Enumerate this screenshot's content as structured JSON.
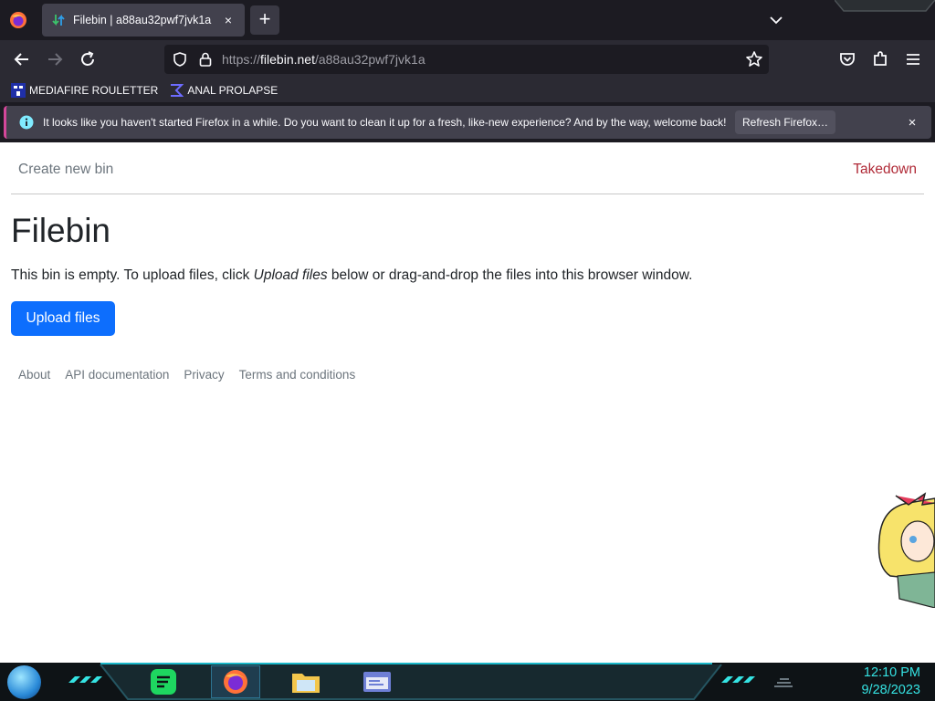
{
  "browser": {
    "tab": {
      "title": "Filebin | a88au32pwf7jvk1a",
      "close": "×"
    },
    "new_tab": "+",
    "url": {
      "scheme": "https://",
      "domain": "filebin.net",
      "path": "/a88au32pwf7jvk1a"
    },
    "bookmarks": [
      {
        "label": "MEDIAFIRE ROULETTER"
      },
      {
        "label": "ANAL PROLAPSE"
      }
    ],
    "notification": {
      "text": "It looks like you haven't started Firefox in a while. Do you want to clean it up for a fresh, like-new experience? And by the way, welcome back!",
      "button": "Refresh Firefox…",
      "close": "×"
    }
  },
  "page": {
    "nav": {
      "create": "Create new bin",
      "takedown": "Takedown"
    },
    "heading": "Filebin",
    "description": {
      "before": "This bin is empty. To upload files, click ",
      "emphasis": "Upload files",
      "after": " below or drag-and-drop the files into this browser window."
    },
    "upload_button": "Upload files",
    "footer": [
      "About",
      "API documentation",
      "Privacy",
      "Terms and conditions"
    ]
  },
  "taskbar": {
    "clock": {
      "time": "12:10 PM",
      "date": "9/28/2023"
    }
  },
  "colors": {
    "primary": "#0d6efd",
    "danger": "#b02a37",
    "muted": "#6c757d",
    "clock": "#35e3e3"
  }
}
